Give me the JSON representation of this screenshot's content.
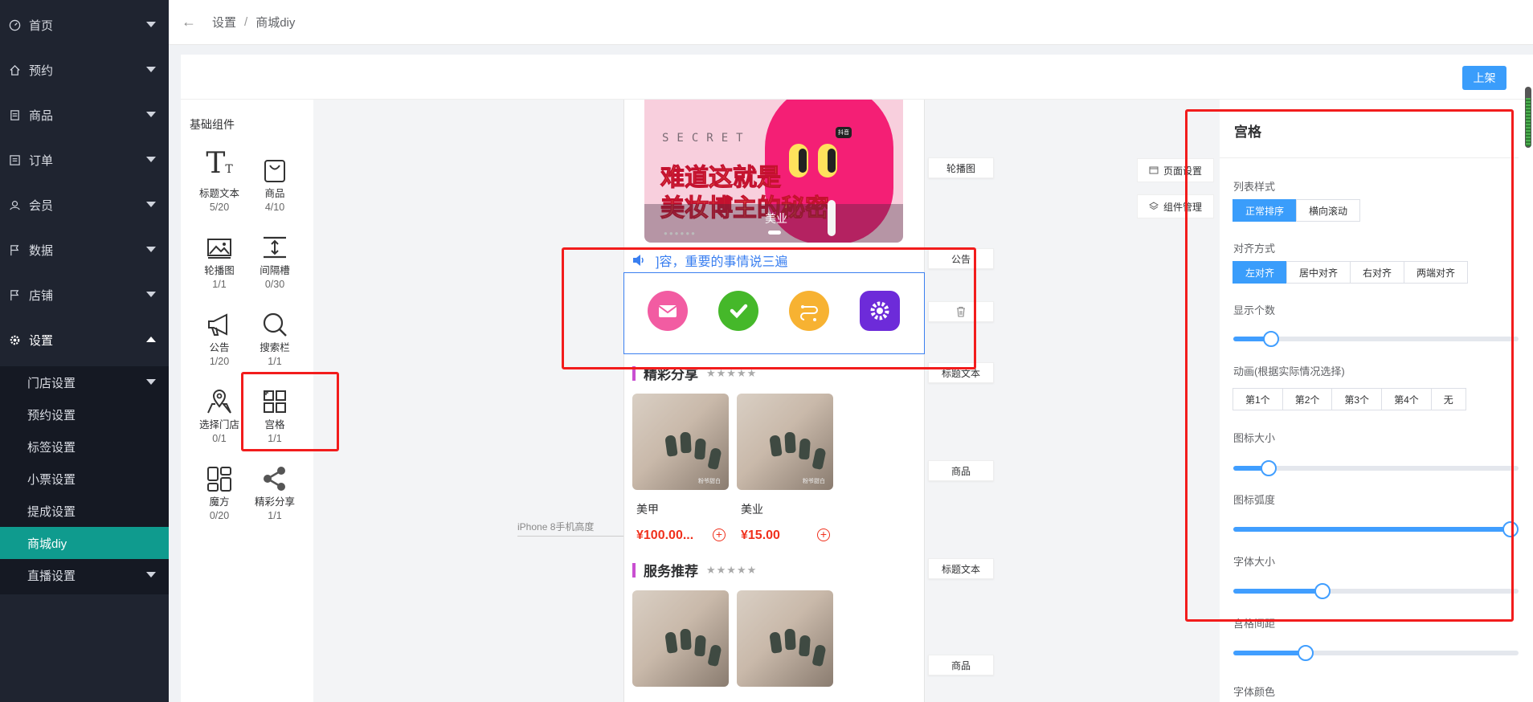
{
  "sidebar": {
    "items": [
      {
        "label": "首页",
        "icon": "dashboard-icon"
      },
      {
        "label": "预约",
        "icon": "home-icon"
      },
      {
        "label": "商品",
        "icon": "document-icon"
      },
      {
        "label": "订单",
        "icon": "list-icon"
      },
      {
        "label": "会员",
        "icon": "user-icon"
      },
      {
        "label": "数据",
        "icon": "flag-icon"
      },
      {
        "label": "店铺",
        "icon": "flag-icon"
      },
      {
        "label": "设置",
        "icon": "gear-icon"
      }
    ],
    "submenu": [
      {
        "label": "门店设置"
      },
      {
        "label": "预约设置"
      },
      {
        "label": "标签设置"
      },
      {
        "label": "小票设置"
      },
      {
        "label": "提成设置"
      },
      {
        "label": "商城diy",
        "active": true
      },
      {
        "label": "直播设置"
      }
    ]
  },
  "breadcrumb": {
    "parent": "设置",
    "separator": "/",
    "current": "商城diy"
  },
  "toolbar": {
    "publish_label": "上架"
  },
  "components": {
    "title": "基础组件",
    "items": [
      {
        "label": "标题文本",
        "count": "5/20",
        "icon": "title-text-icon"
      },
      {
        "label": "商品",
        "count": "4/10",
        "icon": "product-bag-icon"
      },
      {
        "label": "轮播图",
        "count": "1/1",
        "icon": "image-carousel-icon"
      },
      {
        "label": "间隔槽",
        "count": "0/30",
        "icon": "spacer-icon"
      },
      {
        "label": "公告",
        "count": "1/20",
        "icon": "megaphone-icon"
      },
      {
        "label": "搜索栏",
        "count": "1/1",
        "icon": "search-icon"
      },
      {
        "label": "选择门店",
        "count": "0/1",
        "icon": "map-pin-icon"
      },
      {
        "label": "宫格",
        "count": "1/1",
        "icon": "grid-icon"
      },
      {
        "label": "魔方",
        "count": "0/20",
        "icon": "cube-layout-icon"
      },
      {
        "label": "精彩分享",
        "count": "1/1",
        "icon": "share-icon"
      }
    ]
  },
  "preview": {
    "banner": {
      "secret": "SECRET",
      "line1": "难道这就是",
      "line2": "美妆博主的秘密",
      "caption": "美业",
      "tag": "抖音"
    },
    "notice": "]容，重要的事情说三遍",
    "grid_icons": [
      {
        "icon": "mail-icon",
        "color": "#f25ca2"
      },
      {
        "icon": "check-icon",
        "color": "#45b82a"
      },
      {
        "icon": "route-icon",
        "color": "#f7b232"
      },
      {
        "icon": "settings-icon",
        "color": "#6d2bd9"
      }
    ],
    "section1": {
      "title": "精彩分享",
      "stars": "★★★★★"
    },
    "products": [
      {
        "name": "美甲",
        "price": "¥100.00...",
        "watermark": "粉爷甜白"
      },
      {
        "name": "美业",
        "price": "¥15.00",
        "watermark": "粉爷甜白"
      }
    ],
    "section2": {
      "title": "服务推荐",
      "stars": "★★★★★"
    },
    "phone_label": "iPhone 8手机高度",
    "tags": {
      "carousel": "轮播图",
      "notice": "公告",
      "title_text1": "标题文本",
      "product1": "商品",
      "title_text2": "标题文本",
      "product2": "商品"
    },
    "page_settings": "页面设置",
    "component_manage": "组件管理"
  },
  "settings": {
    "title": "宫格",
    "list_style": {
      "label": "列表样式",
      "options": [
        "正常排序",
        "横向滚动"
      ],
      "selected": "正常排序"
    },
    "align": {
      "label": "对齐方式",
      "options": [
        "左对齐",
        "居中对齐",
        "右对齐",
        "两端对齐"
      ],
      "selected": "左对齐"
    },
    "display_count": {
      "label": "显示个数",
      "value": 0.11
    },
    "animation": {
      "label": "动画(根据实际情况选择)",
      "options": [
        "第1个",
        "第2个",
        "第3个",
        "第4个",
        "无"
      ]
    },
    "icon_size": {
      "label": "图标大小",
      "value": 0.1
    },
    "icon_radius": {
      "label": "图标弧度",
      "value": 1.0
    },
    "font_size": {
      "label": "字体大小",
      "value": 0.3
    },
    "grid_spacing": {
      "label": "宫格间距",
      "value": 0.24
    },
    "font_color": {
      "label": "字体颜色"
    }
  },
  "colors": {
    "sidebar": "#1f2430",
    "active": "#0f9b8e",
    "primary": "#3a9dfb",
    "highlight": "#f21c1c"
  }
}
